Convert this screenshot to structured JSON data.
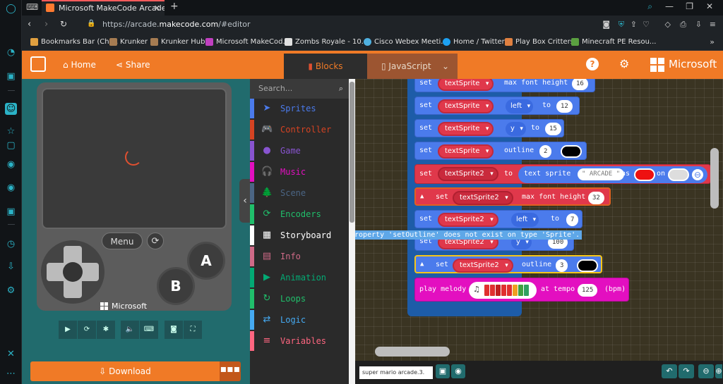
{
  "browser": {
    "tab_title": "Microsoft MakeCode Arcade",
    "url_prefix": "https://arcade.",
    "url_domain": "makecode.com",
    "url_suffix": "/#editor",
    "bookmarks": [
      {
        "label": "Bookmarks Bar (Chr...",
        "color": "#e0a040"
      },
      {
        "label": "Krunker",
        "color": "#a67c52"
      },
      {
        "label": "Krunker Hub",
        "color": "#a67c52"
      },
      {
        "label": "Microsoft MakeCod...",
        "color": "#c040c0"
      },
      {
        "label": "Zombs Royale - 10...",
        "color": "#e0e0e0"
      },
      {
        "label": "Cisco Webex Meeti...",
        "color": "#4fb0e0"
      },
      {
        "label": "Home / Twitter",
        "color": "#1da1f2"
      },
      {
        "label": "Play Box Critters",
        "color": "#e08040"
      },
      {
        "label": "Minecraft PE Resou...",
        "color": "#5aa040"
      }
    ]
  },
  "menu": {
    "home": "Home",
    "share": "Share",
    "blocks": "Blocks",
    "javascript": "JavaScript",
    "brand": "Microsoft"
  },
  "simulator": {
    "menu_label": "Menu",
    "a_label": "A",
    "b_label": "B",
    "brand": "Microsoft",
    "download": "Download",
    "more": "▪▪▪"
  },
  "toolbox": {
    "search_placeholder": "Search...",
    "categories": [
      {
        "label": "Sprites",
        "color": "#4b7bec",
        "icon": "➤"
      },
      {
        "label": "Controller",
        "color": "#d54322",
        "icon": "🎮"
      },
      {
        "label": "Game",
        "color": "#8854d0",
        "icon": "●"
      },
      {
        "label": "Music",
        "color": "#e30fc0",
        "icon": "🎧"
      },
      {
        "label": "Scene",
        "color": "#4b6584",
        "icon": "🌲"
      },
      {
        "label": "Encoders",
        "color": "#20bf6b",
        "icon": "⟳"
      },
      {
        "label": "Storyboard",
        "color": "#ffffff",
        "icon": "▦"
      },
      {
        "label": "Info",
        "color": "#cf6a87",
        "icon": "▤"
      },
      {
        "label": "Animation",
        "color": "#03aa74",
        "icon": "▶"
      },
      {
        "label": "Loops",
        "color": "#20bf6b",
        "icon": "↻"
      },
      {
        "label": "Logic",
        "color": "#45aaf2",
        "icon": "⇄"
      },
      {
        "label": "Variables",
        "color": "#ff6680",
        "icon": "≡"
      }
    ]
  },
  "blocks": {
    "kw_set": "set",
    "kw_to": "to",
    "kw_as": "as",
    "kw_on": "on",
    "var1": "textSprite",
    "var2": "textSprite2",
    "prop_max_font": "max font height",
    "prop_left": "left",
    "prop_y": "y",
    "prop_outline": "outline",
    "val_max_font_1": "16",
    "val_left_1": "12",
    "val_y_1": "15",
    "val_outline_1": "2",
    "text_sprite_kw": "text sprite",
    "text_sprite_str": "\" ARCADE \"",
    "val_max_font_2": "32",
    "val_left_2": "7",
    "val_y_2": "100",
    "val_outline_2": "3",
    "play_melody": "play melody",
    "at_tempo": "at tempo",
    "tempo_val": "125",
    "bpm": "(bpm)",
    "tooltip": "Property 'setOutline' does not exist on type 'Sprite'."
  },
  "workspace": {
    "filename": "super mario arcade.3."
  }
}
